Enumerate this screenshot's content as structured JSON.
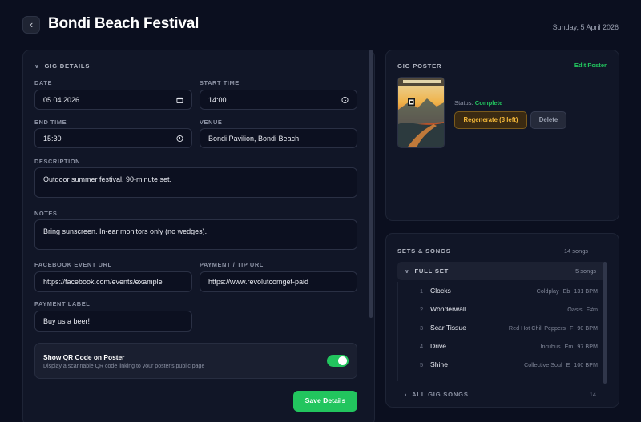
{
  "header": {
    "back_icon": "chevron-left-icon",
    "title": "Bondi Beach Festival",
    "date": "Sunday, 5 April 2026"
  },
  "gig_details": {
    "section_title": "GIG DETAILS",
    "date_label": "DATE",
    "date_value": "05.04.2026",
    "start_time_label": "START TIME",
    "start_time_value": "14:00",
    "end_time_label": "END TIME",
    "end_time_value": "15:30",
    "venue_label": "VENUE",
    "venue_value": "Bondi Pavilion, Bondi Beach",
    "description_label": "DESCRIPTION",
    "description_value": "Outdoor summer festival. 90-minute set.",
    "notes_label": "NOTES",
    "notes_value": "Bring sunscreen. In-ear monitors only (no wedges).",
    "facebook_label": "FACEBOOK EVENT URL",
    "facebook_value": "https://facebook.com/events/example",
    "payment_url_label": "PAYMENT / TIP URL",
    "payment_url_value": "https://www.revolutcomget-paid",
    "payment_label_label": "PAYMENT LABEL",
    "payment_label_value": "Buy us a beer!",
    "qr_title": "Show QR Code on Poster",
    "qr_subtitle": "Display a scannable QR code linking to your poster's public page",
    "qr_enabled": true,
    "save_label": "Save Details"
  },
  "poster": {
    "section_title": "GIG POSTER",
    "edit_label": "Edit Poster",
    "status_label": "Status:",
    "status_value": "Complete",
    "regenerate_label": "Regenerate (3 left)",
    "delete_label": "Delete"
  },
  "songs": {
    "section_title": "SETS & SONGS",
    "count": "14 songs",
    "full_set": {
      "name": "FULL SET",
      "count": "5 songs"
    },
    "items": [
      {
        "num": "1",
        "title": "Clocks",
        "artist": "Coldplay",
        "key": "Eb",
        "bpm": "131 BPM"
      },
      {
        "num": "2",
        "title": "Wonderwall",
        "artist": "Oasis",
        "key": "F#m",
        "bpm": ""
      },
      {
        "num": "3",
        "title": "Scar Tissue",
        "artist": "Red Hot Chili Peppers",
        "key": "F",
        "bpm": "90 BPM"
      },
      {
        "num": "4",
        "title": "Drive",
        "artist": "Incubus",
        "key": "Em",
        "bpm": "97 BPM"
      },
      {
        "num": "5",
        "title": "Shine",
        "artist": "Collective Soul",
        "key": "E",
        "bpm": "100 BPM"
      }
    ],
    "all_songs": {
      "name": "ALL GIG SONGS",
      "count": "14"
    }
  },
  "colors": {
    "background": "#0b0f1f",
    "panel": "#111627",
    "accent_green": "#22c55e",
    "warning_amber": "#f5b93a"
  }
}
